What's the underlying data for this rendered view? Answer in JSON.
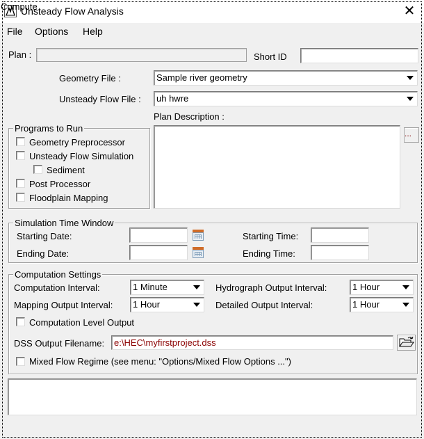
{
  "window": {
    "title": "Unsteady Flow Analysis",
    "close_glyph": "✕"
  },
  "menu": [
    "File",
    "Options",
    "Help"
  ],
  "plan": {
    "plan_label": "Plan :",
    "plan_value": "",
    "short_id_label": "Short ID",
    "short_id_value": ""
  },
  "geometry": {
    "label": "Geometry File :",
    "selected": "Sample river geometry"
  },
  "unsteady": {
    "label": "Unsteady Flow File :",
    "selected": "uh hwre"
  },
  "description": {
    "label": "Plan Description :",
    "value": "",
    "button_label": "..."
  },
  "programs": {
    "title": "Programs to Run",
    "items": [
      {
        "label": "Geometry Preprocessor",
        "checked": false
      },
      {
        "label": "Unsteady Flow Simulation",
        "checked": false
      },
      {
        "label": "Sediment",
        "checked": false
      },
      {
        "label": "Post Processor",
        "checked": false
      },
      {
        "label": "Floodplain Mapping",
        "checked": false
      }
    ]
  },
  "time_window": {
    "title": "Simulation Time Window",
    "starting_date_label": "Starting Date:",
    "ending_date_label": "Ending Date:",
    "starting_time_label": "Starting Time:",
    "ending_time_label": "Ending Time:",
    "starting_date": "",
    "ending_date": "",
    "starting_time": "",
    "ending_time": ""
  },
  "computation": {
    "title": "Computation Settings",
    "computation_interval_label": "Computation Interval:",
    "computation_interval": "1 Minute",
    "hydrograph_interval_label": "Hydrograph Output Interval:",
    "hydrograph_interval": "1 Hour",
    "mapping_interval_label": "Mapping Output Interval:",
    "mapping_interval": "1 Hour",
    "detailed_interval_label": "Detailed Output Interval:",
    "detailed_interval": "1 Hour",
    "computation_level_label": "Computation Level Output",
    "computation_level_checked": false,
    "dss_label": "DSS Output Filename:",
    "dss_value": "e:\\HEC\\myfirstproject.dss",
    "mixed_flow_label": "Mixed Flow Regime (see menu: \"Options/Mixed Flow Options ...\")",
    "mixed_flow_checked": false
  },
  "messages": "",
  "compute_label": "Compute",
  "colors": {
    "dss_text": "#8b0000",
    "window_bg": "#f0f0f0"
  }
}
